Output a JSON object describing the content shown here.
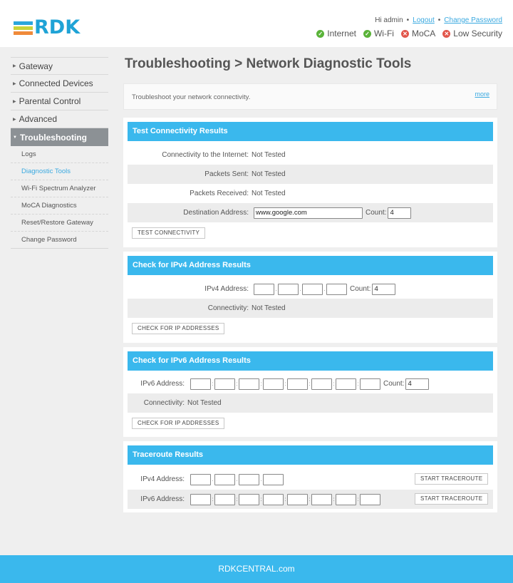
{
  "header": {
    "logo_text": "RDK",
    "logo_colors": [
      "#2aa6dc",
      "#c8d43a",
      "#f08a3a"
    ],
    "greeting": "Hi admin",
    "logout": "Logout",
    "change_password": "Change Password",
    "statuses": [
      {
        "label": "Internet",
        "state": "ok",
        "icon": "check-circle-icon"
      },
      {
        "label": "Wi-Fi",
        "state": "ok",
        "icon": "check-circle-icon"
      },
      {
        "label": "MoCA",
        "state": "error",
        "icon": "x-circle-icon"
      },
      {
        "label": "Low Security",
        "state": "error",
        "icon": "x-circle-icon"
      }
    ]
  },
  "sidebar": {
    "items": [
      {
        "label": "Gateway"
      },
      {
        "label": "Connected Devices"
      },
      {
        "label": "Parental Control"
      },
      {
        "label": "Advanced"
      },
      {
        "label": "Troubleshooting",
        "active": true
      }
    ],
    "subitems": [
      {
        "label": "Logs"
      },
      {
        "label": "Diagnostic Tools",
        "current": true
      },
      {
        "label": "Wi-Fi Spectrum Analyzer"
      },
      {
        "label": "MoCA Diagnostics"
      },
      {
        "label": "Reset/Restore Gateway"
      },
      {
        "label": "Change Password"
      }
    ]
  },
  "main": {
    "title": "Troubleshooting > Network Diagnostic Tools",
    "intro": "Troubleshoot your network connectivity.",
    "more": "more",
    "test_connectivity": {
      "title": "Test Connectivity Results",
      "internet_label": "Connectivity to the Internet:",
      "internet_value": "Not Tested",
      "sent_label": "Packets Sent:",
      "sent_value": "Not Tested",
      "received_label": "Packets Received:",
      "received_value": "Not Tested",
      "destination_label": "Destination Address:",
      "destination_value": "www.google.com",
      "count_label": "Count:",
      "count_value": "4",
      "button": "TEST  CONNECTIVITY"
    },
    "ipv4_check": {
      "title": "Check for IPv4 Address Results",
      "address_label": "IPv4 Address:",
      "count_label": "Count:",
      "count_value": "4",
      "connectivity_label": "Connectivity:",
      "connectivity_value": "Not Tested",
      "button": "CHECK FOR IP ADDRESSES"
    },
    "ipv6_check": {
      "title": "Check for IPv6 Address Results",
      "address_label": "IPv6 Address:",
      "count_label": "Count:",
      "count_value": "4",
      "connectivity_label": "Connectivity:",
      "connectivity_value": "Not Tested",
      "button": "CHECK FOR IP ADDRESSES"
    },
    "traceroute": {
      "title": "Traceroute Results",
      "ipv4_label": "IPv4 Address:",
      "ipv6_label": "IPv6 Address:",
      "button": "START TRACEROUTE"
    }
  },
  "footer": {
    "text": "RDKCENTRAL.com"
  }
}
